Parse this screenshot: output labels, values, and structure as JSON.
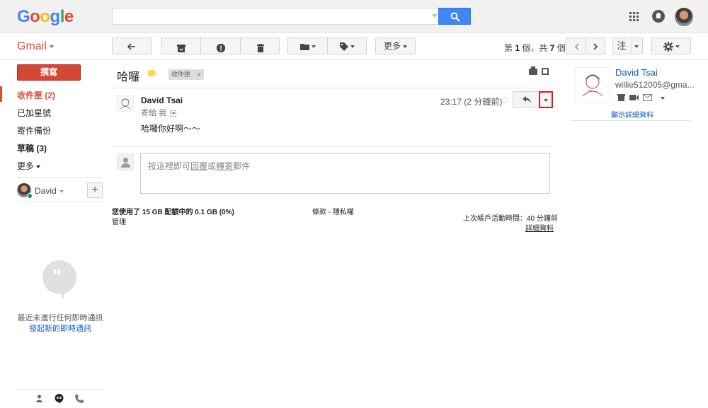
{
  "header": {
    "logo_letters": [
      "G",
      "o",
      "o",
      "g",
      "l",
      "e"
    ],
    "search": {
      "value": "",
      "placeholder": ""
    }
  },
  "toolbar": {
    "app_label": "Gmail",
    "more_label": "更多",
    "pagination": {
      "prefix": "第",
      "current": "1",
      "mid": "個，共",
      "total": "7",
      "suffix": "個"
    },
    "input_tools_label": "注"
  },
  "sidebar": {
    "compose_label": "撰寫",
    "items": [
      {
        "label": "收件匣 (2)"
      },
      {
        "label": "已加星號"
      },
      {
        "label": "寄件備份"
      },
      {
        "label": "草稿 (3)"
      },
      {
        "label": "更多"
      }
    ],
    "user_name": "David",
    "no_chats_text": "最近未進行任何即時通訊",
    "start_chat_link": "發起新的即時通訊"
  },
  "conversation": {
    "subject": "哈囉",
    "label_chip": "收件匣",
    "label_chip_close": "x",
    "message": {
      "sender": "David Tsai",
      "to_prefix": "寄給",
      "to_recipient": "我",
      "timestamp": "23:17 (2 分鐘前)",
      "body": "哈囉你好啊～～"
    },
    "reply_box": {
      "prefix": "按這裡即可",
      "reply_link": "回覆",
      "mid": "或",
      "forward_link": "轉寄",
      "suffix": "郵件"
    }
  },
  "footer": {
    "storage": "您使用了 15 GB 配額中的 0.1 GB (0%)",
    "manage": "管理",
    "terms": "條款 - 隱私權",
    "last_activity": "上次帳戶活動時間：40 分鐘前",
    "details": "詳細資料"
  },
  "contact_card": {
    "name": "David Tsai",
    "email": "willie512005@gma...",
    "show_details": "顯示詳細資料"
  },
  "colors": {
    "accent_red": "#dd4b39",
    "link_blue": "#1155cc",
    "search_blue": "#4285f4",
    "highlight_box": "#e01b1b"
  }
}
